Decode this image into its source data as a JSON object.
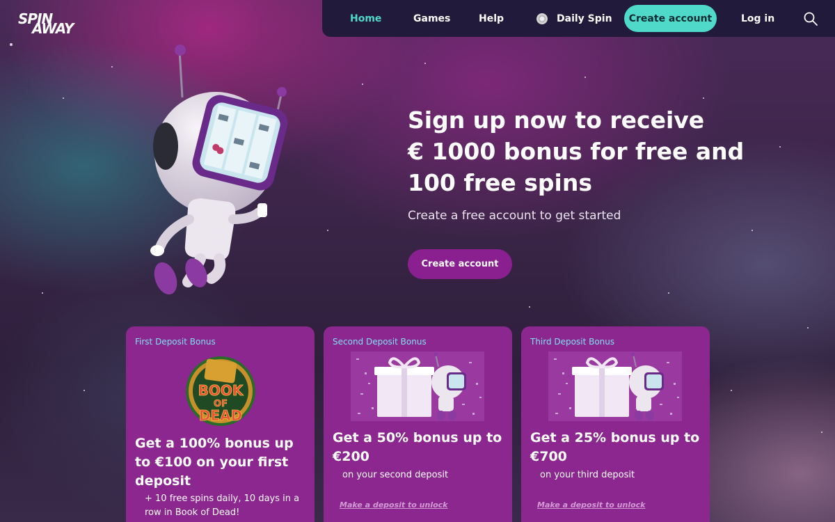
{
  "logo": {
    "text": "SPIN AWAY",
    "line1": "SPIN",
    "line2": "AWAY"
  },
  "nav": {
    "items": [
      {
        "label": "Home",
        "active": true
      },
      {
        "label": "Games",
        "active": false
      },
      {
        "label": "Help",
        "active": false
      },
      {
        "label": "Daily Spin",
        "active": false
      }
    ],
    "create_account": "Create account",
    "login": "Log in",
    "search_icon": "search-icon",
    "accent_color": "#4fd9c9"
  },
  "hero": {
    "title_line1": "Sign up now to receive",
    "title_line2": "€ 1000 bonus for free and",
    "title_line3": "100 free spins",
    "subtitle": "Create a free account to get started",
    "cta": "Create account",
    "cta_color": "#8a1f8f"
  },
  "cards": [
    {
      "label": "First Deposit Bonus",
      "title": "Get a 100% bonus up to €100 on your first deposit",
      "sub": "+ 10 free spins daily, 10 days in a row in Book of Dead!",
      "image": "Book of Dead logo",
      "image_line1": "BOOK",
      "image_line2": "OF",
      "image_line3": "DEAD"
    },
    {
      "label": "Second Deposit Bonus",
      "title": "Get a 50% bonus up to €200",
      "sub": "on your second deposit",
      "link": "Make a deposit to unlock",
      "image": "gift box with robot"
    },
    {
      "label": "Third Deposit Bonus",
      "title": "Get a 25% bonus up to €700",
      "sub": "on your third deposit",
      "link": "Make a deposit to unlock",
      "image": "gift box with robot"
    }
  ],
  "card_color": "#8c2790"
}
